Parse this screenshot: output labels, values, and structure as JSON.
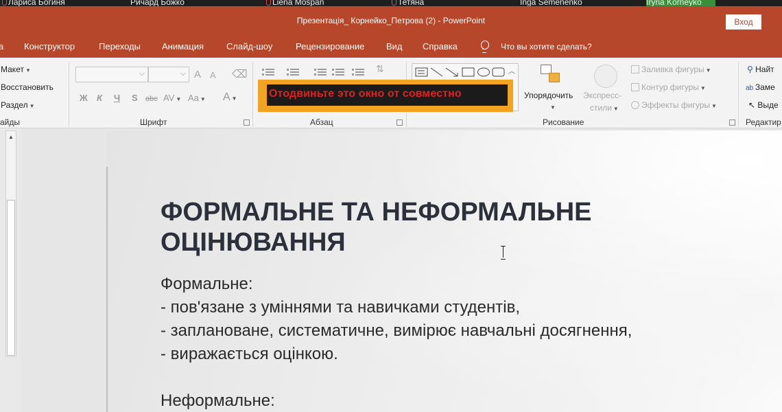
{
  "participants": [
    {
      "name": "Лариса Богиня"
    },
    {
      "name": "Ричард Божко"
    },
    {
      "name": "Liena Mospan"
    },
    {
      "name": "Тетяна"
    },
    {
      "name": "Inga Semenenko"
    },
    {
      "name": "Iryna Korneyko"
    }
  ],
  "window": {
    "title": "Презентація_ Корнейко_Петрова (2)  -  PowerPoint",
    "login_label": "Вход"
  },
  "tabs": [
    "а",
    "Конструктор",
    "Переходы",
    "Анимация",
    "Слайд-шоу",
    "Рецензирование",
    "Вид",
    "Справка"
  ],
  "tell_me": "Что вы хотите сделать?",
  "ribbon": {
    "slides": {
      "layout": "Макет",
      "reset": "Восстановить",
      "section": "Раздел",
      "label": "айды"
    },
    "font": {
      "grow": "A",
      "shrink": "A",
      "bold": "Ж",
      "italic": "К",
      "underline": "Ч",
      "strike": "S",
      "strikethrough_abc": "abc",
      "spacing": "AV",
      "case": "Aa",
      "color": "A",
      "label": "Шрифт"
    },
    "paragraph": {
      "label": "Абзац"
    },
    "drawing": {
      "arrange": "Упорядочить",
      "quick_styles_1": "Экспресс-",
      "quick_styles_2": "стили",
      "fill": "Заливка фигуры",
      "outline": "Контур фигуры",
      "effects": "Эффекты фигуры",
      "label": "Рисование"
    },
    "editing": {
      "find": "Найт",
      "replace": "Заме",
      "select": "Выде",
      "label": "Редактир"
    }
  },
  "share_banner": {
    "text": "Отодвиньте это окно от совместно"
  },
  "slide": {
    "title_line1": "ФОРМАЛЬНЕ ТА НЕФОРМАЛЬНЕ",
    "title_line2": "ОЦІНЮВАННЯ",
    "body": [
      "Формальне:",
      "- пов'язане з уміннями та навичками студентів,",
      "- заплановане, систематичне, вимірює навчальні досягнення,",
      "- виражається оцінкою.",
      "",
      "Неформальне:"
    ]
  },
  "colors": {
    "accent": "#b7472a",
    "banner": "#f3a31f",
    "banner_text": "#e32020"
  }
}
